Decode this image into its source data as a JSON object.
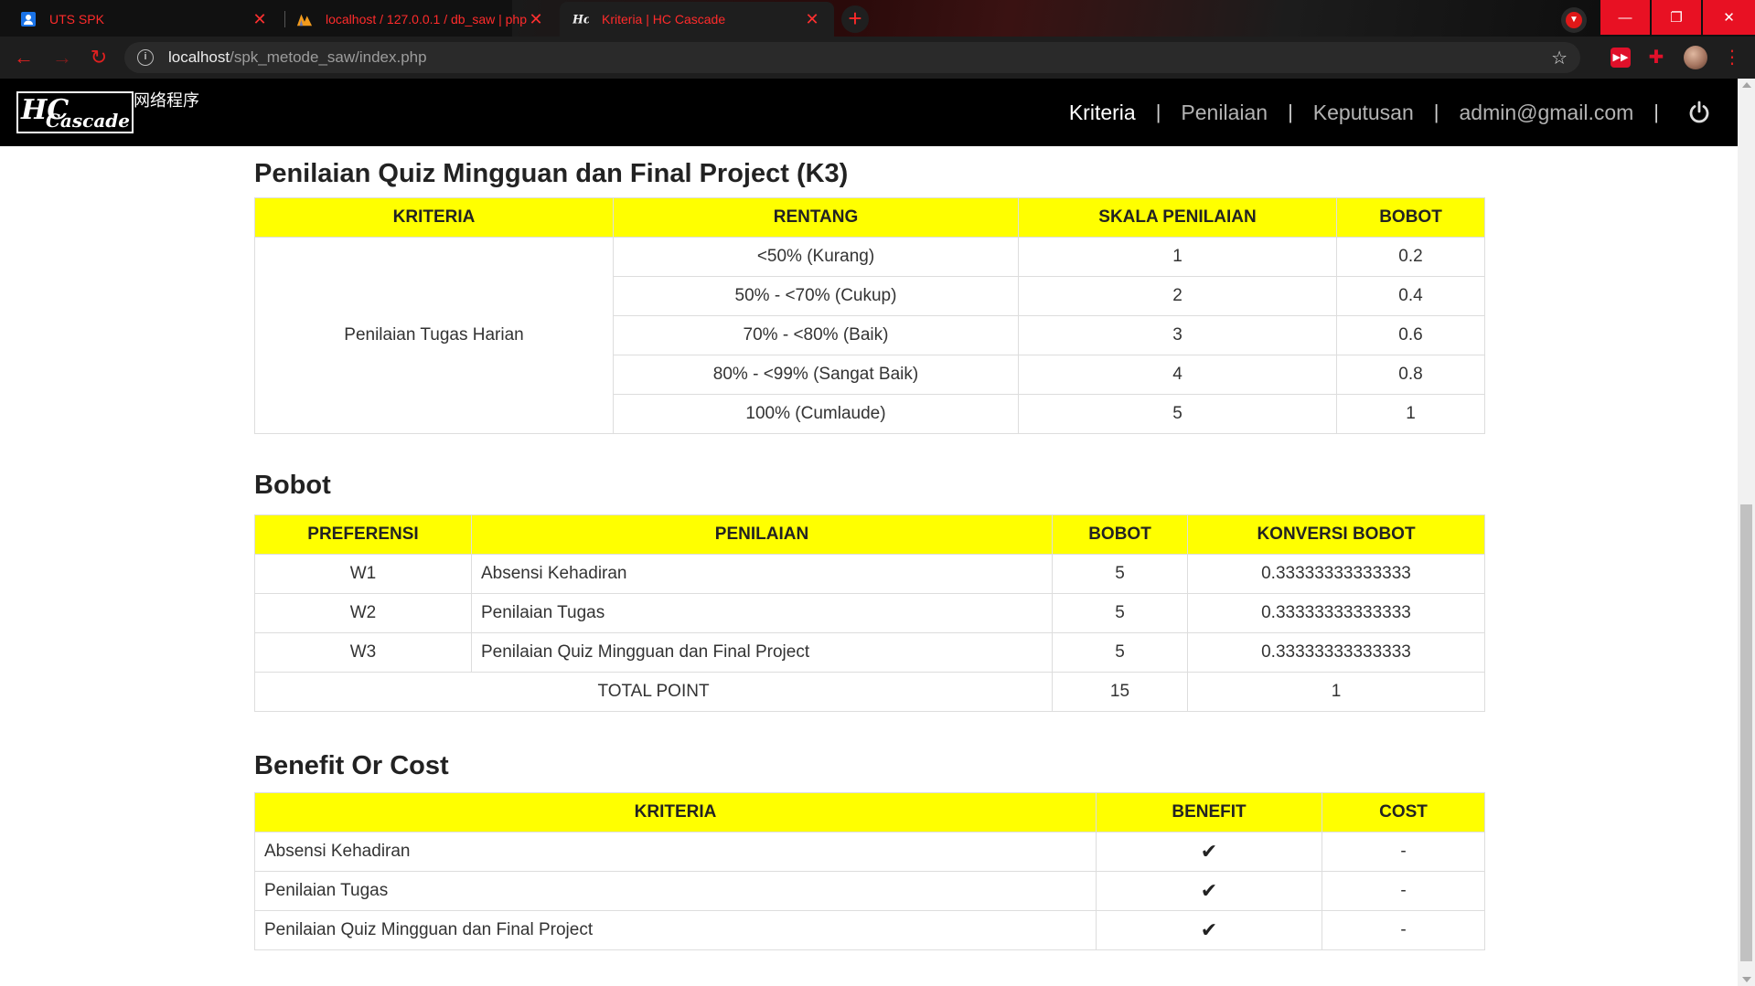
{
  "browser": {
    "tabs": [
      {
        "title": "UTS SPK",
        "icon": "user-avatar-icon"
      },
      {
        "title": "localhost / 127.0.0.1 / db_saw | php",
        "icon": "phpmyadmin-icon"
      },
      {
        "title": "Kriteria | HC Cascade",
        "icon": "hc-logo-icon"
      }
    ],
    "url_host": "localhost",
    "url_path": "/spk_metode_saw/index.php",
    "accent": "#ff2b2b"
  },
  "navbar": {
    "logo_text": "HC",
    "logo_chinese": "网络程序",
    "logo_sub": "Cascade",
    "menu": [
      "Kriteria",
      "Penilaian",
      "Keputusan",
      "admin@gmail.com"
    ],
    "separator": "|"
  },
  "k3": {
    "heading": "Penilaian Quiz Mingguan dan Final Project (K3)",
    "headers": [
      "KRITERIA",
      "RENTANG",
      "SKALA PENILAIAN",
      "BOBOT"
    ],
    "kriteria": "Penilaian Tugas Harian",
    "rows": [
      {
        "rentang": "<50% (Kurang)",
        "skala": "1",
        "bobot": "0.2"
      },
      {
        "rentang": "50% - <70% (Cukup)",
        "skala": "2",
        "bobot": "0.4"
      },
      {
        "rentang": "70% - <80% (Baik)",
        "skala": "3",
        "bobot": "0.6"
      },
      {
        "rentang": "80% - <99% (Sangat Baik)",
        "skala": "4",
        "bobot": "0.8"
      },
      {
        "rentang": "100% (Cumlaude)",
        "skala": "5",
        "bobot": "1"
      }
    ]
  },
  "bobot": {
    "heading": "Bobot",
    "headers": [
      "PREFERENSI",
      "PENILAIAN",
      "BOBOT",
      "KONVERSI BOBOT"
    ],
    "rows": [
      {
        "pref": "W1",
        "penilaian": "Absensi Kehadiran",
        "bobot": "5",
        "konversi": "0.33333333333333"
      },
      {
        "pref": "W2",
        "penilaian": "Penilaian Tugas",
        "bobot": "5",
        "konversi": "0.33333333333333"
      },
      {
        "pref": "W3",
        "penilaian": "Penilaian Quiz Mingguan dan Final Project",
        "bobot": "5",
        "konversi": "0.33333333333333"
      }
    ],
    "total_label": "TOTAL POINT",
    "total_bobot": "15",
    "total_konversi": "1"
  },
  "benefit_cost": {
    "heading": "Benefit Or Cost",
    "headers": [
      "KRITERIA",
      "BENEFIT",
      "COST"
    ],
    "rows": [
      {
        "kriteria": "Absensi Kehadiran",
        "benefit": "✔",
        "cost": "-"
      },
      {
        "kriteria": "Penilaian Tugas",
        "benefit": "✔",
        "cost": "-"
      },
      {
        "kriteria": "Penilaian Quiz Mingguan dan Final Project",
        "benefit": "✔",
        "cost": "-"
      }
    ]
  },
  "colors": {
    "header_bg": "#ffff00",
    "navbar_bg": "#000000"
  }
}
